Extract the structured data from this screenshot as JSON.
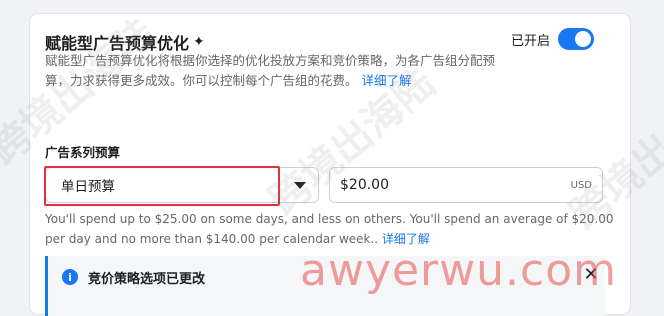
{
  "section": {
    "title": "赋能型广告预算优化",
    "sparkle_icon": "sparkle-icon",
    "toggle_label": "已开启",
    "toggle_on": true,
    "description": "赋能型广告预算优化将根据你选择的优化投放方案和竞价策略，为各广告组分配预算，力求获得更多成效。你可以控制每个广告组的花费。",
    "learn_more": "详细了解"
  },
  "budget": {
    "label": "广告系列预算",
    "type_value": "单日预算",
    "amount_value": "$20.00",
    "currency": "USD",
    "helper_text": "You'll spend up to $25.00 on some days, and less on others. You'll spend an average of $20.00 per day and no more than $140.00 per calendar week.. ",
    "helper_link": "详细了解"
  },
  "notice": {
    "title": "竞价策略选项已更改",
    "icon": "info-icon",
    "close_icon": "close-icon"
  },
  "watermarks": {
    "left": "跨境出海陆",
    "center": "跨境出海陆",
    "right": "跨境出"
  },
  "brand_mark": "awyerwu.com",
  "colors": {
    "accent": "#1877f2",
    "highlight": "#e0313c",
    "text": "#1c1e21",
    "muted": "#65676b"
  }
}
